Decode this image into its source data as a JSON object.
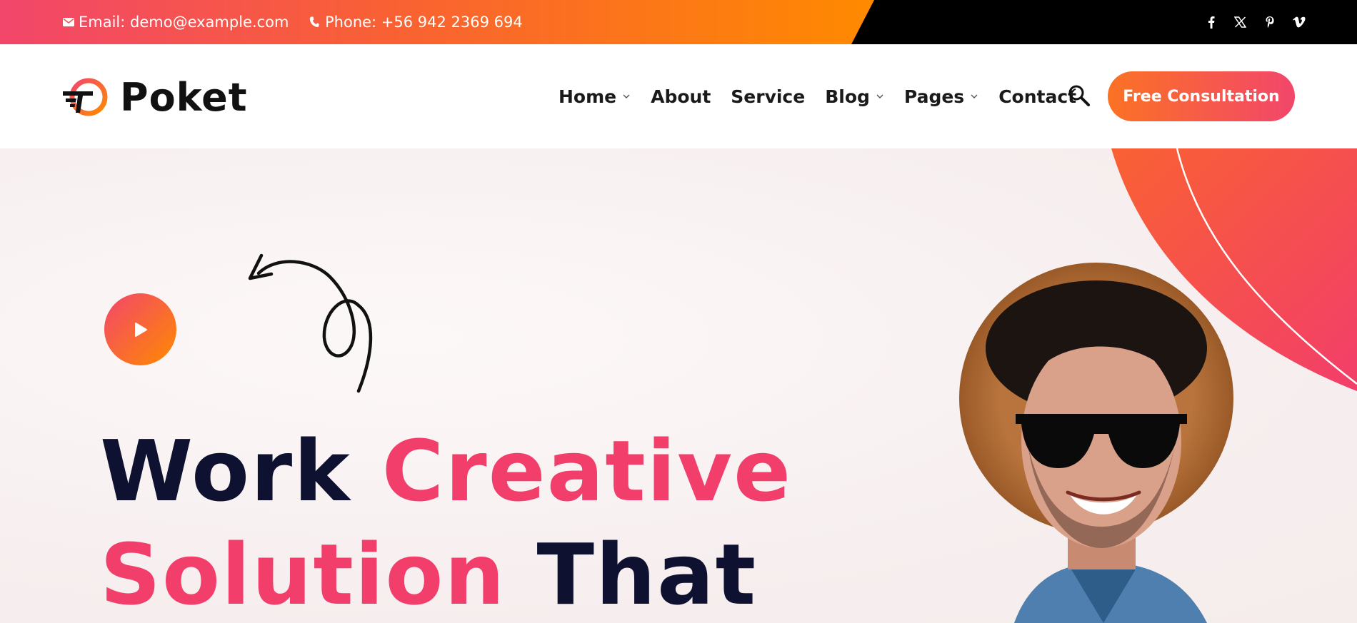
{
  "topbar": {
    "email": "Email: demo@example.com",
    "phone": "Phone: +56 942 2369 694",
    "social": [
      "facebook-icon",
      "x-icon",
      "pinterest-icon",
      "vimeo-icon"
    ]
  },
  "header": {
    "logo_text": "Poket",
    "nav": [
      {
        "label": "Home",
        "has_dropdown": true
      },
      {
        "label": "About",
        "has_dropdown": false
      },
      {
        "label": "Service",
        "has_dropdown": false
      },
      {
        "label": "Blog",
        "has_dropdown": true
      },
      {
        "label": "Pages",
        "has_dropdown": true
      },
      {
        "label": "Contact",
        "has_dropdown": false
      }
    ],
    "cta_label": "Free Consultation"
  },
  "hero": {
    "line1_dark": "Work",
    "line1_pink": "Creative",
    "line2_pink": "Solution",
    "line2_dark": "That"
  },
  "colors": {
    "brand_pink": "#f23e6a",
    "brand_orange": "#ff8a00",
    "headline_dark": "#0e1230"
  }
}
